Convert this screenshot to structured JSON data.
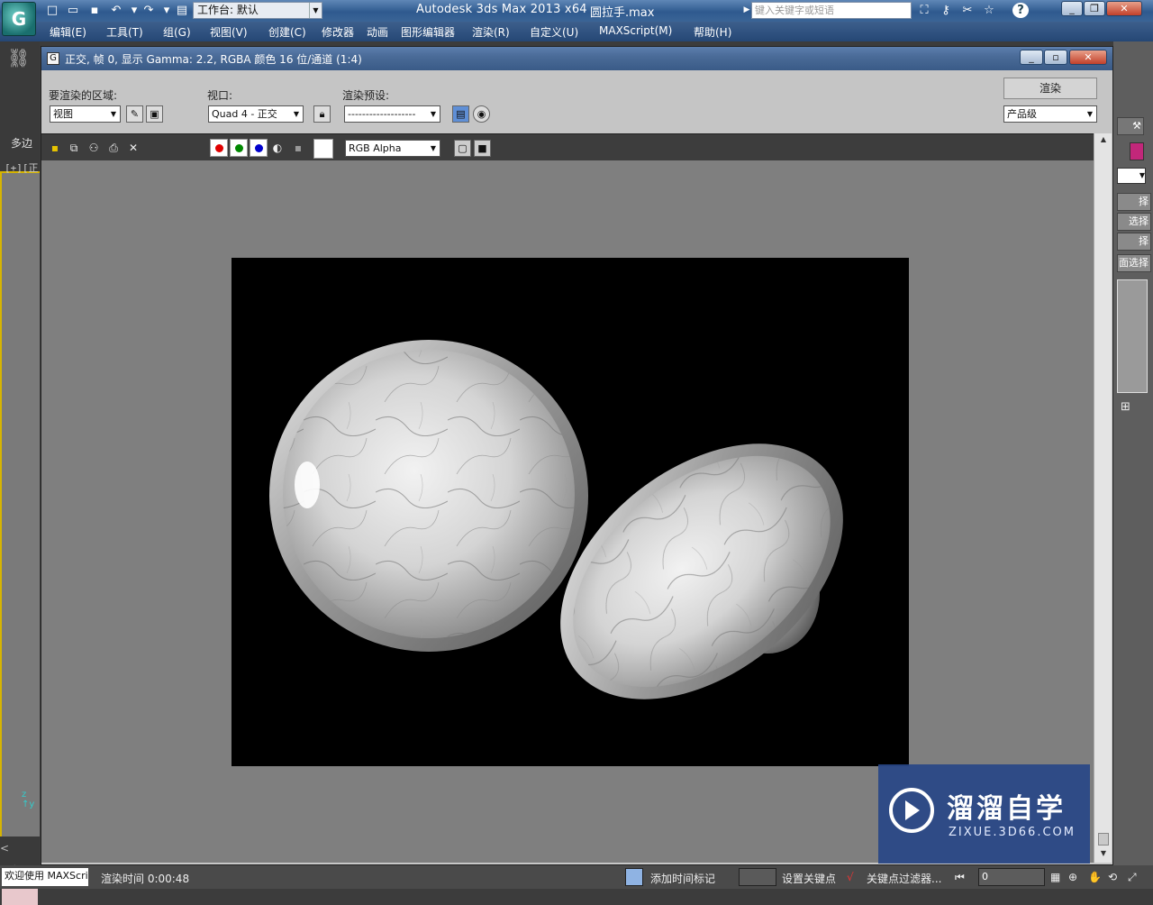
{
  "app": {
    "logo_glyph": "G",
    "workspace_label": "工作台: 默认",
    "title": "Autodesk 3ds Max  2013 x64",
    "file_name": "圆拉手.max",
    "search_placeholder": "键入关键字或短语"
  },
  "menu": [
    "编辑(E)",
    "工具(T)",
    "组(G)",
    "视图(V)",
    "创建(C)",
    "修改器",
    "动画",
    "图形编辑器",
    "渲染(R)",
    "自定义(U)",
    "MAXScript(M)",
    "帮助(H)"
  ],
  "left_panel": {
    "tab_label": "多边",
    "viewport_label": "[+][正"
  },
  "right_panel": {
    "buttons": [
      "择",
      "选择",
      "择",
      "面选择"
    ]
  },
  "render_window": {
    "title": "正交, 帧 0, 显示 Gamma: 2.2, RGBA 颜色 16 位/通道 (1:4)",
    "area_label": "要渲染的区域:",
    "area_value": "视图",
    "viewport_label": "视口:",
    "viewport_value": "Quad 4 - 正交",
    "preset_label": "渲染预设:",
    "preset_value": "-------------------",
    "render_button": "渲染",
    "quality_value": "产品级",
    "channel_value": "RGB Alpha"
  },
  "watermark": {
    "title": "溜溜自学",
    "url": "ZIXUE.3D66.COM"
  },
  "status": {
    "welcome": "欢迎使用 MAXScri",
    "render_time": "渲染时间  0:00:48",
    "add_time_tag": "添加时间标记",
    "set_key": "设置关键点",
    "key_filters": "关键点过滤器...",
    "frame_value": "0"
  },
  "colors": {
    "titlebar": "#3a6496",
    "menubar": "#254775",
    "canvas_bg": "#7f7f7f",
    "render_bg": "#000000",
    "watermark_bg": "#28468c"
  }
}
